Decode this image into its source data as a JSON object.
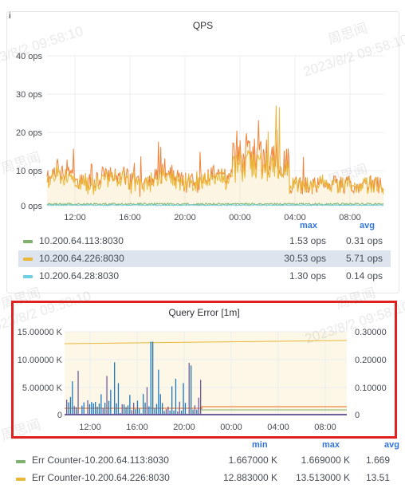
{
  "qps_panel": {
    "info_icon": "i",
    "title": "QPS",
    "y_ticks": [
      "40 ops",
      "30 ops",
      "20 ops",
      "10 ops",
      "0 ops"
    ],
    "x_ticks": [
      "12:00",
      "16:00",
      "20:00",
      "00:00",
      "04:00",
      "08:00"
    ],
    "legend_headers": {
      "max": "max",
      "avg": "avg"
    },
    "legend": [
      {
        "name": "10.200.64.113:8030",
        "max": "1.53 ops",
        "avg": "0.31 ops",
        "color": "#7eb26d"
      },
      {
        "name": "10.200.64.226:8030",
        "max": "30.53 ops",
        "avg": "5.71 ops",
        "color": "#eab839"
      },
      {
        "name": "10.200.64.28:8030",
        "max": "1.30 ops",
        "avg": "0.14 ops",
        "color": "#6ed0e0"
      }
    ]
  },
  "query_error_panel": {
    "title": "Query Error [1m]",
    "y_left_ticks": [
      "15.00000 K",
      "10.00000 K",
      "5.00000 K",
      "0"
    ],
    "y_right_ticks": [
      "0.30000",
      "0.20000",
      "0.10000",
      "0"
    ],
    "x_ticks": [
      "12:00",
      "16:00",
      "20:00",
      "00:00",
      "04:00",
      "08:00"
    ],
    "legend_headers": {
      "min": "min",
      "max": "max",
      "avg": "avg"
    },
    "legend": [
      {
        "name": "Err Counter-10.200.64.113:8030",
        "min": "1.667000 K",
        "max": "1.669000 K",
        "avg": "1.669",
        "color": "#7eb26d"
      },
      {
        "name": "Err Counter-10.200.64.226:8030",
        "min": "12.883000 K",
        "max": "13.513000 K",
        "avg": "13.51",
        "color": "#eab839"
      }
    ]
  },
  "watermark": {
    "name": "周思闻",
    "time": "2023/8/2 09:58:10"
  },
  "chart_data": [
    {
      "type": "line",
      "title": "QPS",
      "x": [
        "12:00",
        "16:00",
        "20:00",
        "00:00",
        "04:00",
        "08:00"
      ],
      "ylim": [
        0,
        40
      ],
      "series": [
        {
          "name": "10.200.64.113:8030",
          "max": 1.53,
          "avg": 0.31
        },
        {
          "name": "10.200.64.226:8030",
          "max": 30.53,
          "avg": 5.71
        },
        {
          "name": "10.200.64.28:8030",
          "max": 1.3,
          "avg": 0.14
        }
      ]
    },
    {
      "type": "bar",
      "title": "Query Error [1m]",
      "x": [
        "12:00",
        "16:00",
        "20:00",
        "00:00",
        "04:00",
        "08:00"
      ],
      "ylim": [
        0,
        15000
      ],
      "series": [
        {
          "name": "Err Counter-10.200.64.113:8030",
          "min": 1667,
          "max": 1669
        },
        {
          "name": "Err Counter-10.200.64.226:8030",
          "min": 12883,
          "max": 13513
        }
      ]
    }
  ]
}
